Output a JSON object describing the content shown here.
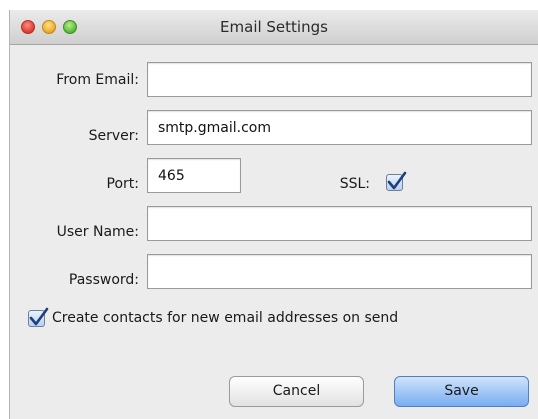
{
  "window": {
    "title": "Email Settings"
  },
  "form": {
    "from_email": {
      "label": "From Email:",
      "value": ""
    },
    "server": {
      "label": "Server:",
      "value": "smtp.gmail.com"
    },
    "port": {
      "label": "Port:",
      "value": "465"
    },
    "ssl": {
      "label": "SSL:",
      "checked": true
    },
    "user_name": {
      "label": "User Name:",
      "value": ""
    },
    "password": {
      "label": "Password:",
      "value": ""
    },
    "create_contacts": {
      "label": "Create contacts for new email addresses on send",
      "checked": true
    }
  },
  "buttons": {
    "cancel": "Cancel",
    "save": "Save"
  },
  "colors": {
    "accent": "#1f5fbf"
  }
}
